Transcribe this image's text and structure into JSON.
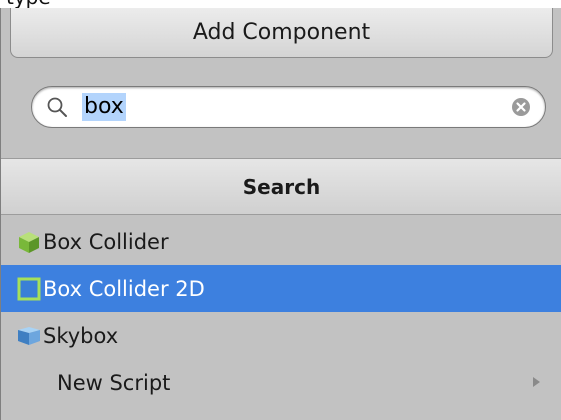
{
  "caption_fragment": "type",
  "header": {
    "title": "Add Component"
  },
  "search": {
    "value": "box"
  },
  "section": {
    "label": "Search"
  },
  "items": [
    {
      "label": "Box Collider",
      "icon": "box-collider-icon"
    },
    {
      "label": "Box Collider 2D",
      "icon": "box-collider-2d-icon",
      "selected": true
    },
    {
      "label": "Skybox",
      "icon": "skybox-icon"
    },
    {
      "label": "New Script",
      "icon": "none",
      "has_submenu": true
    }
  ],
  "colors": {
    "selection": "#3d80df",
    "panel": "#c2c2c2",
    "search_highlight": "#b3d4fc"
  }
}
